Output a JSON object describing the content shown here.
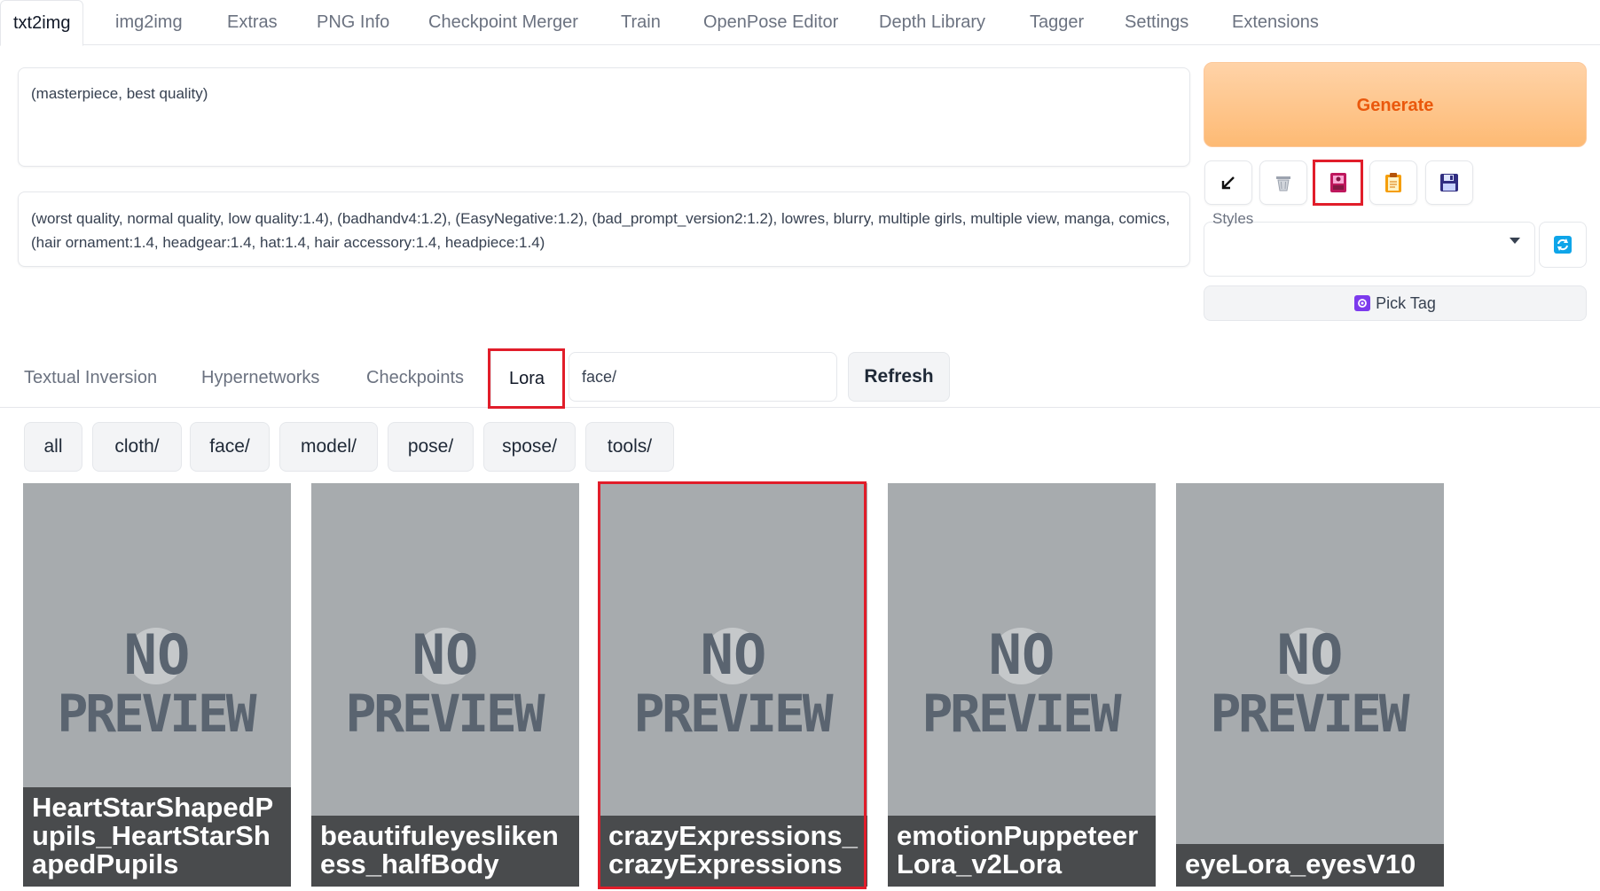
{
  "top_tabs": [
    {
      "label": "txt2img",
      "active": true
    },
    {
      "label": "img2img"
    },
    {
      "label": "Extras"
    },
    {
      "label": "PNG Info"
    },
    {
      "label": "Checkpoint Merger"
    },
    {
      "label": "Train"
    },
    {
      "label": "OpenPose Editor"
    },
    {
      "label": "Depth Library"
    },
    {
      "label": "Tagger"
    },
    {
      "label": "Settings"
    },
    {
      "label": "Extensions"
    }
  ],
  "prompt": {
    "positive": "(masterpiece, best quality)",
    "negative": "(worst quality, normal quality, low quality:1.4), (badhandv4:1.2), (EasyNegative:1.2), (bad_prompt_version2:1.2), lowres, blurry, multiple girls, multiple view, manga, comics, (hair ornament:1.4, headgear:1.4, hat:1.4, hair accessory:1.4, headpiece:1.4)"
  },
  "generate": {
    "label": "Generate"
  },
  "tools": [
    {
      "name": "read-params-arrow-icon"
    },
    {
      "name": "trash-icon"
    },
    {
      "name": "extra-networks-card-icon",
      "highlighted": true
    },
    {
      "name": "clipboard-icon"
    },
    {
      "name": "save-floppy-icon"
    }
  ],
  "styles": {
    "label": "Styles",
    "value": ""
  },
  "pick_tag": {
    "label": "Pick Tag"
  },
  "network_tabs": [
    {
      "label": "Textual Inversion"
    },
    {
      "label": "Hypernetworks"
    },
    {
      "label": "Checkpoints"
    },
    {
      "label": "Lora",
      "active": true,
      "highlighted": true
    }
  ],
  "search": {
    "value": "face/"
  },
  "refresh": {
    "label": "Refresh"
  },
  "filters": [
    "all",
    "cloth/",
    "face/",
    "model/",
    "pose/",
    "spose/",
    "tools/"
  ],
  "no_preview": {
    "line1": "NO",
    "line2": "PREVIEW"
  },
  "cards": [
    {
      "label": "HeartStarShapedPupils_HeartStarShapedPupils"
    },
    {
      "label": "beautifuleyeslikeness_halfBody"
    },
    {
      "label": "crazyExpressions_crazyExpressions",
      "highlighted": true
    },
    {
      "label": "emotionPuppeteerLora_v2Lora"
    },
    {
      "label": "eyeLora_eyesV10"
    }
  ],
  "colors": {
    "accent": "#ea580c",
    "highlight": "#e11d2a",
    "card_bg": "#a7abae"
  }
}
